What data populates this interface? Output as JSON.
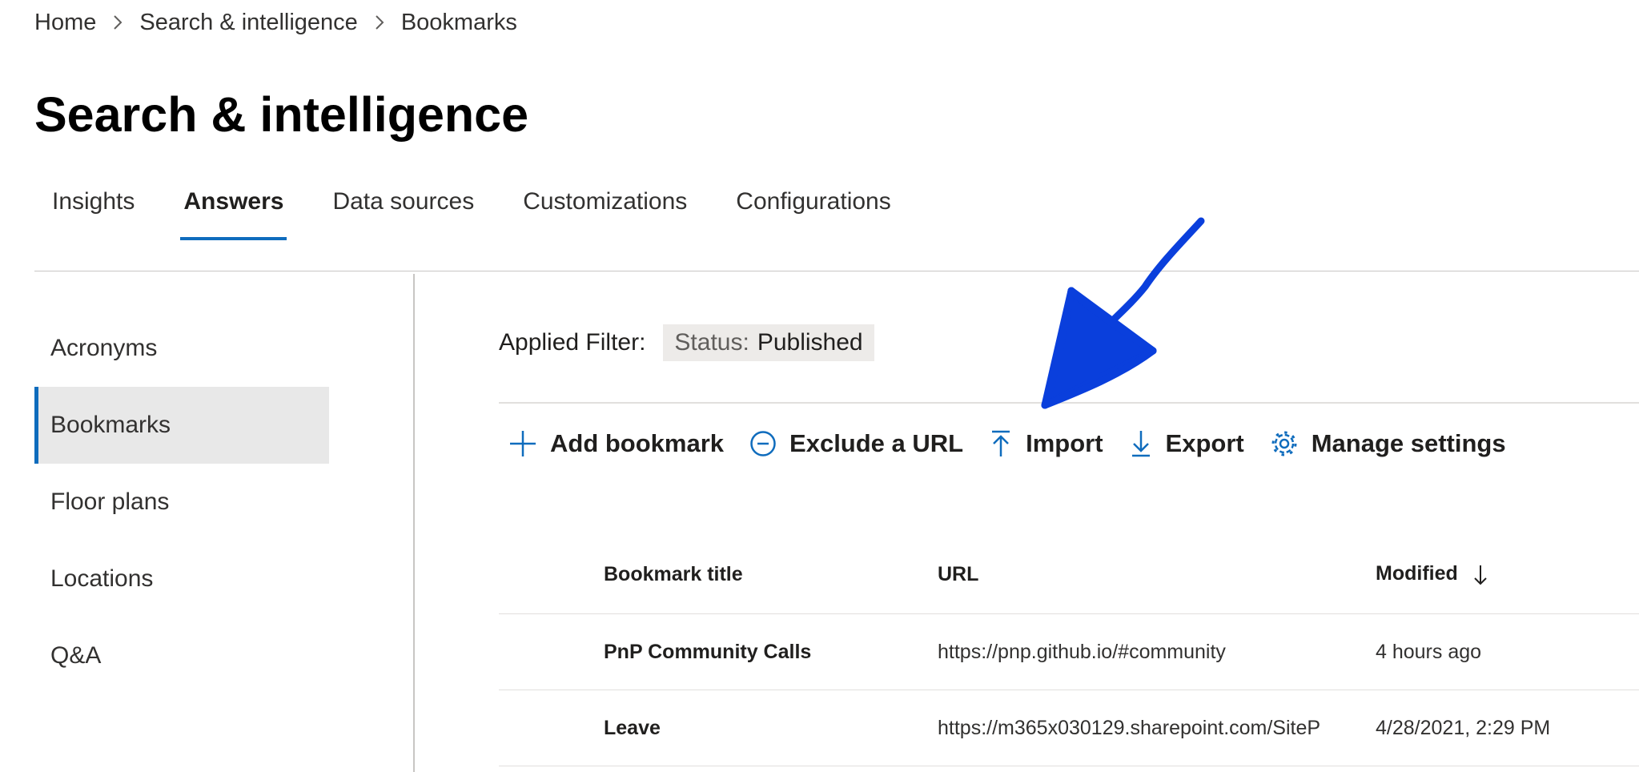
{
  "breadcrumb": [
    "Home",
    "Search & intelligence",
    "Bookmarks"
  ],
  "page_title": "Search & intelligence",
  "tabs": [
    {
      "label": "Insights"
    },
    {
      "label": "Answers",
      "active": true
    },
    {
      "label": "Data sources"
    },
    {
      "label": "Customizations"
    },
    {
      "label": "Configurations"
    }
  ],
  "sidebar": {
    "items": [
      {
        "label": "Acronyms"
      },
      {
        "label": "Bookmarks",
        "active": true
      },
      {
        "label": "Floor plans"
      },
      {
        "label": "Locations"
      },
      {
        "label": "Q&A"
      }
    ]
  },
  "filter": {
    "label": "Applied Filter:",
    "key": "Status:",
    "value": "Published"
  },
  "toolbar": {
    "add": "Add bookmark",
    "exclude": "Exclude a URL",
    "import": "Import",
    "export": "Export",
    "manage": "Manage settings"
  },
  "table": {
    "headers": {
      "title": "Bookmark title",
      "url": "URL",
      "modified": "Modified"
    },
    "rows": [
      {
        "title": "PnP Community Calls",
        "url": "https://pnp.github.io/#community",
        "modified": "4 hours ago"
      },
      {
        "title": "Leave",
        "url": "https://m365x030129.sharepoint.com/SiteP",
        "modified": "4/28/2021, 2:29 PM"
      }
    ]
  },
  "colors": {
    "accent": "#0f6cbd",
    "annotation": "#0a3fdc"
  },
  "icons": [
    "chevron-right-icon",
    "plus-icon",
    "minus-circle-icon",
    "upload-icon",
    "download-icon",
    "gear-icon",
    "arrow-down-icon"
  ]
}
